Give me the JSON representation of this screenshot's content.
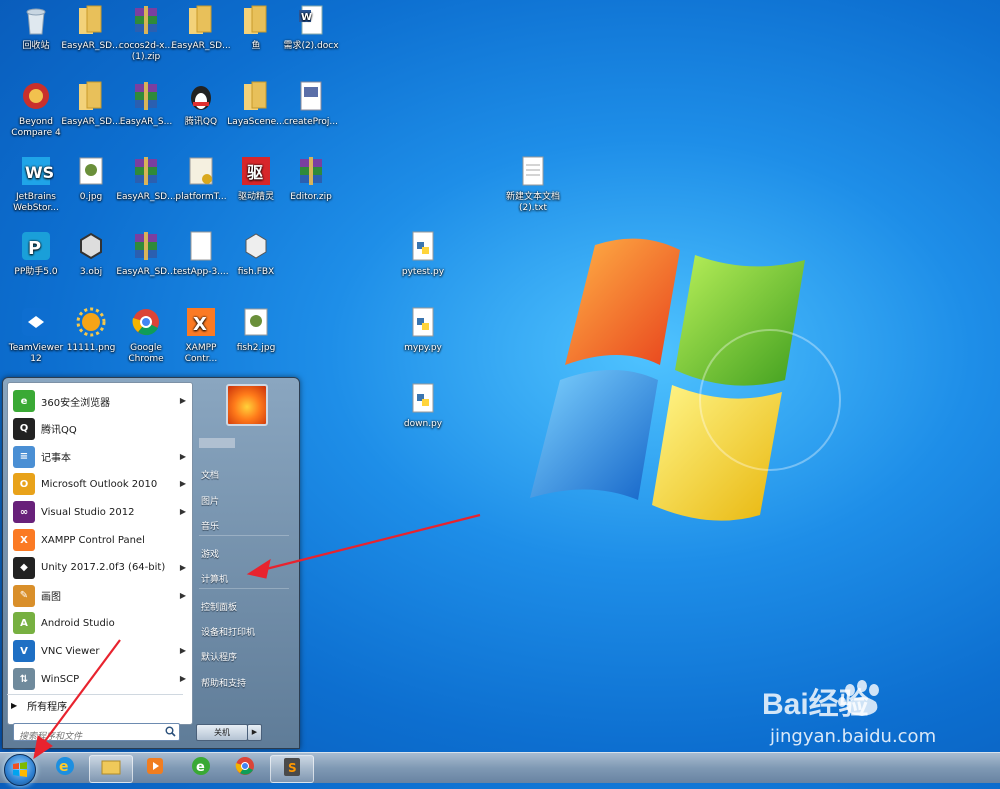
{
  "desktop": {
    "icons": [
      {
        "label": "回收站",
        "icon": "recycle-bin-icon"
      },
      {
        "label": "EasyAR_SD...",
        "icon": "folder-icon"
      },
      {
        "label": "cocos2d-x... (1).zip",
        "icon": "winrar-archive-icon"
      },
      {
        "label": "EasyAR_SD...",
        "icon": "folder-icon"
      },
      {
        "label": "鱼",
        "icon": "folder-icon"
      },
      {
        "label": "需求(2).docx",
        "icon": "word-document-icon"
      },
      {
        "label": "Beyond Compare 4",
        "icon": "beyond-compare-icon"
      },
      {
        "label": "EasyAR_SD...",
        "icon": "folder-icon"
      },
      {
        "label": "EasyAR_S...",
        "icon": "winrar-archive-icon"
      },
      {
        "label": "腾讯QQ",
        "icon": "qq-penguin-icon"
      },
      {
        "label": "LayaScene...",
        "icon": "folder-icon"
      },
      {
        "label": "createProj...",
        "icon": "batch-file-icon"
      },
      {
        "label": "JetBrains WebStor...",
        "icon": "webstorm-icon"
      },
      {
        "label": "0.jpg",
        "icon": "image-file-icon"
      },
      {
        "label": "EasyAR_SD...",
        "icon": "winrar-archive-icon"
      },
      {
        "label": "platformT...",
        "icon": "config-file-icon"
      },
      {
        "label": "驱动精灵",
        "icon": "driver-genius-icon"
      },
      {
        "label": "Editor.zip",
        "icon": "winrar-archive-icon"
      },
      {
        "label": "新建文本文档 (2).txt",
        "icon": "text-file-icon"
      },
      {
        "label": "PP助手5.0",
        "icon": "pp-assistant-icon"
      },
      {
        "label": "3.obj",
        "icon": "obj-model-icon"
      },
      {
        "label": "EasyAR_SD...",
        "icon": "winrar-archive-icon"
      },
      {
        "label": "testApp-3....",
        "icon": "blank-file-icon"
      },
      {
        "label": "fish.FBX",
        "icon": "fbx-model-icon"
      },
      {
        "label": "pytest.py",
        "icon": "python-file-icon"
      },
      {
        "label": "TeamViewer 12",
        "icon": "teamviewer-icon"
      },
      {
        "label": "11111.png",
        "icon": "sun-image-icon"
      },
      {
        "label": "Google Chrome",
        "icon": "chrome-icon"
      },
      {
        "label": "XAMPP Contr...",
        "icon": "xampp-icon"
      },
      {
        "label": "fish2.jpg",
        "icon": "image-file-icon"
      },
      {
        "label": "mypy.py",
        "icon": "python-file-icon"
      },
      {
        "label": "down.py",
        "icon": "python-file-icon"
      }
    ]
  },
  "start_menu": {
    "programs": [
      {
        "label": "360安全浏览器",
        "icon": "360-browser-icon",
        "color": "#3aa935",
        "submenu": true
      },
      {
        "label": "腾讯QQ",
        "icon": "qq-penguin-icon",
        "color": "#222222",
        "submenu": false
      },
      {
        "label": "记事本",
        "icon": "notepad-icon",
        "color": "#4a8fd4",
        "submenu": true
      },
      {
        "label": "Microsoft Outlook 2010",
        "icon": "outlook-icon",
        "color": "#e8a21a",
        "submenu": true
      },
      {
        "label": "Visual Studio 2012",
        "icon": "visual-studio-icon",
        "color": "#68217a",
        "submenu": true
      },
      {
        "label": "XAMPP Control Panel",
        "icon": "xampp-icon",
        "color": "#fb7a24",
        "submenu": false
      },
      {
        "label": "Unity 2017.2.0f3 (64-bit)",
        "icon": "unity-icon",
        "color": "#222222",
        "submenu": true
      },
      {
        "label": "画图",
        "icon": "paint-icon",
        "color": "#d98f2a",
        "submenu": true
      },
      {
        "label": "Android Studio",
        "icon": "android-studio-icon",
        "color": "#77b041",
        "submenu": false
      },
      {
        "label": "VNC Viewer",
        "icon": "vnc-viewer-icon",
        "color": "#1e6fc4",
        "submenu": true
      },
      {
        "label": "WinSCP",
        "icon": "winscp-icon",
        "color": "#6f8a9c",
        "submenu": true
      }
    ],
    "all_programs_label": "所有程序",
    "search_placeholder": "搜索程序和文件",
    "right_links": [
      "文档",
      "图片",
      "音乐",
      "游戏",
      "计算机",
      "控制面板",
      "设备和打印机",
      "默认程序",
      "帮助和支持"
    ],
    "shutdown_label": "关机"
  },
  "taskbar": {
    "items": [
      {
        "icon": "internet-explorer-icon"
      },
      {
        "icon": "file-explorer-icon"
      },
      {
        "icon": "media-player-icon"
      },
      {
        "icon": "360-browser-icon"
      },
      {
        "icon": "chrome-icon"
      },
      {
        "icon": "sublime-text-icon"
      }
    ]
  },
  "watermark": {
    "brand": "Bai经验",
    "url": "jingyan.baidu.com"
  },
  "colors": {
    "annotation_arrow": "#e8232e",
    "desktop_blue": "#1e8ee8"
  }
}
